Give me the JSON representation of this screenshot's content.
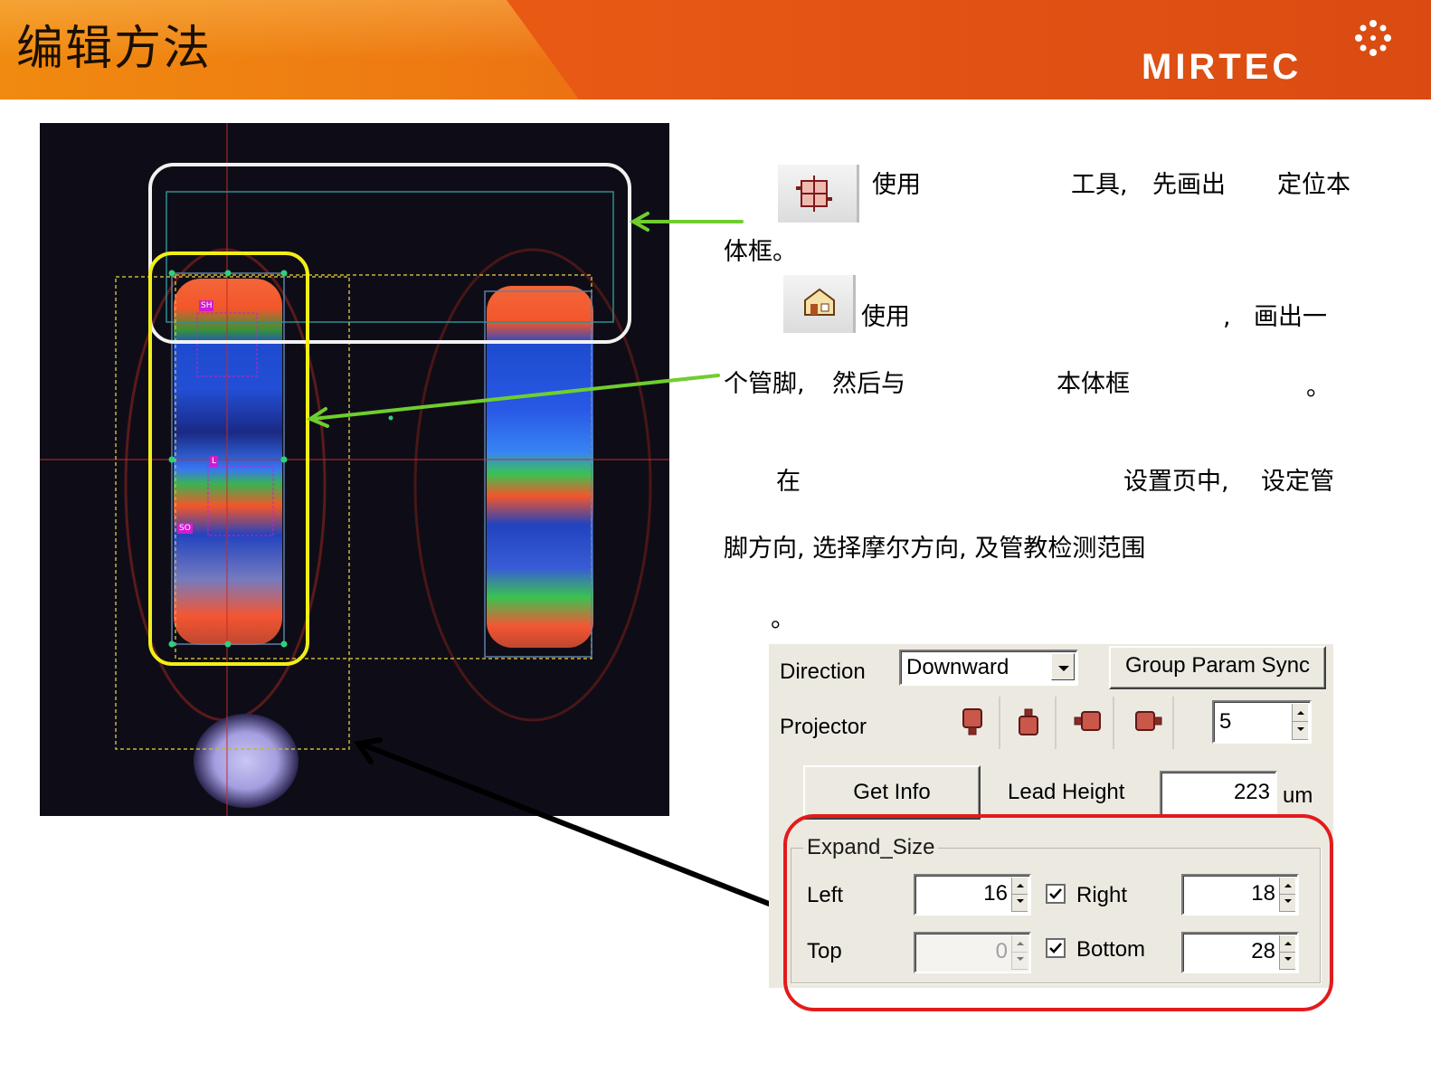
{
  "header": {
    "title": "编辑方法",
    "brand": "MIRTEC"
  },
  "inspection_image": {
    "tags": [
      "SH",
      "L",
      "SO"
    ],
    "annotation_colors": {
      "body_frame": "#ffffff",
      "lead_frame": "#f2ef17",
      "arrow": "#6fce2e",
      "expand_arrow": "#000000"
    }
  },
  "instructions": {
    "line1": [
      "使用",
      "工具,",
      "先画出",
      "定位本"
    ],
    "line2": "体框。",
    "line3": [
      "使用",
      ",",
      "画出一"
    ],
    "line4": [
      "个管脚,",
      "然后与",
      "本体框",
      "。"
    ],
    "line5": [
      "在",
      "设置页中,",
      "设定管"
    ],
    "line6": "脚方向, 选择摩尔方向, 及管教检测范围",
    "line7": "。",
    "tools": [
      "body-frame-tool-icon",
      "lead-tool-icon"
    ]
  },
  "panel": {
    "direction_label": "Direction",
    "direction_value": "Downward",
    "group_sync_label": "Group Param Sync",
    "projector_label": "Projector",
    "projector_value": "5",
    "get_info_label": "Get Info",
    "lead_height_label": "Lead Height",
    "lead_height_value": "223",
    "lead_height_unit": "um",
    "expand": {
      "title": "Expand_Size",
      "left_label": "Left",
      "left_value": "16",
      "right_label": "Right",
      "right_value": "18",
      "right_checked": true,
      "top_label": "Top",
      "top_value": "0",
      "bottom_label": "Bottom",
      "bottom_value": "28",
      "bottom_checked": true
    },
    "highlight_color": "#e31b1b"
  }
}
